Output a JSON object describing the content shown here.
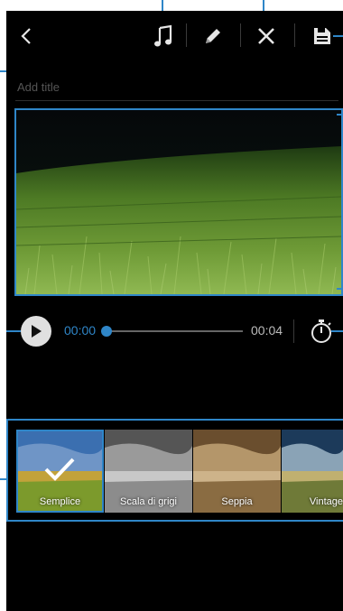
{
  "toolbar": {
    "back": "back-arrow-icon",
    "music": "music-note-icon",
    "edit": "pencil-icon",
    "close": "close-icon",
    "save": "save-icon"
  },
  "title_field": {
    "placeholder": "Add title"
  },
  "player": {
    "time_start": "00:00",
    "time_end": "00:04",
    "progress": 0
  },
  "filters": [
    {
      "label": "Semplice",
      "selected": true
    },
    {
      "label": "Scala di grigi",
      "selected": false
    },
    {
      "label": "Seppia",
      "selected": false
    },
    {
      "label": "Vintage",
      "selected": false
    }
  ],
  "colors": {
    "accent": "#2f86c8",
    "background": "#000000"
  }
}
